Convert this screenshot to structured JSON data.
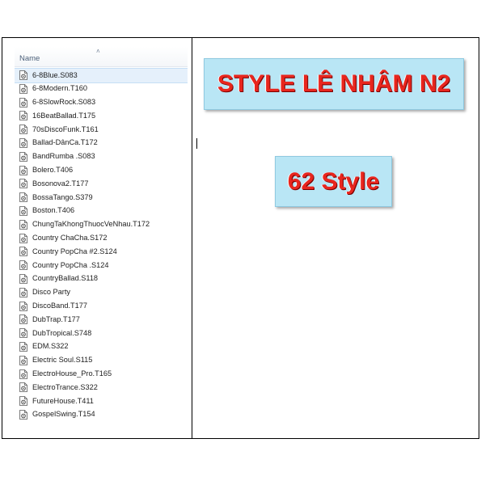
{
  "explorer": {
    "column_header": "Name",
    "sort_icon": "chevron-up-icon",
    "files": [
      "6-8Blue.S083",
      "6-8Modern.T160",
      "6-8SlowRock.S083",
      "16BeatBallad.T175",
      "70sDiscoFunk.T161",
      "Ballad-DânCa.T172",
      "BandRumba .S083",
      "Bolero.T406",
      "Bosonova2.T177",
      "BossaTango.S379",
      "Boston.T406",
      "ChungTaKhongThuocVeNhau.T172",
      "Country ChaCha.S172",
      "Country PopCha #2.S124",
      "Country PopCha .S124",
      "CountryBallad.S118",
      "Disco Party",
      "DiscoBand.T177",
      "DubTrap.T177",
      "DubTropical.S748",
      "EDM.S322",
      "Electric Soul.S115",
      "ElectroHouse_Pro.T165",
      "ElectroTrance.S322",
      "FutureHouse.T411",
      "GospelSwing.T154"
    ],
    "selected_index": 0,
    "file_icon": "style-file-icon"
  },
  "banners": {
    "title": "STYLE LÊ NHÂM N2",
    "count": "62 Style"
  }
}
